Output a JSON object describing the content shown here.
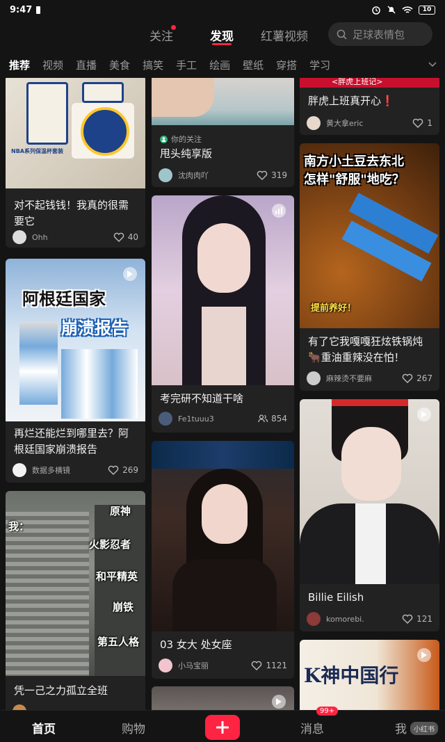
{
  "status": {
    "time": "9:47",
    "battery": "10"
  },
  "top_nav": {
    "follow": "关注",
    "discover": "发现",
    "video": "红薯视频",
    "search_placeholder": "足球表情包"
  },
  "categories": [
    "推荐",
    "视频",
    "直播",
    "美食",
    "搞笑",
    "手工",
    "绘画",
    "壁纸",
    "穿搭",
    "学习"
  ],
  "cards": [
    {
      "title_line1": "对不起钱钱！我真的很需",
      "title_line2": "要它",
      "author": "Ohh",
      "likes": "40",
      "img_text_a": "WARRIORS",
      "img_text_b": "NBA系列保温杯套装"
    },
    {
      "title_line1": "再烂还能烂到哪里去？阿",
      "title_line2": "根廷国家崩溃报告",
      "author": "数据多横镜",
      "likes": "269",
      "img_text_a": "阿根廷国家",
      "img_text_b": "崩溃报告"
    },
    {
      "title_line1": "凭一己之力孤立全班",
      "author": "",
      "likes": "",
      "img_text_a": "我：",
      "labels": [
        "原神",
        "火影忍者",
        "和平精英",
        "崩铁",
        "第五人格"
      ]
    },
    {
      "follow_tag": "你的关注",
      "title_line1": "甩头纯享版",
      "author": "沈肉肉吖",
      "likes": "319"
    },
    {
      "title_line1": "考完研不知道干啥",
      "author": "Fe1tuuu3",
      "likes": "854"
    },
    {
      "title_line1": "03 女大 处女座",
      "author": "小马宝丽",
      "likes": "1121"
    },
    {
      "title_line1": "胖虎上班真开心❗",
      "author": "黄大拿eric",
      "likes": "1",
      "img_text_a": "<胖虎上班记>"
    },
    {
      "title_line1": "有了它我嘎嘎狂炫铁锅炖",
      "title_line2": "🐂重油重辣没在怕！",
      "author": "麻辣烫不要麻",
      "likes": "267",
      "img_text_a": "南方小土豆去东北",
      "img_text_b": "怎样\"舒服\"地吃？",
      "img_text_c": "提前养好！"
    },
    {
      "title_line1": "Billie Eilish",
      "author": "komorebi.",
      "likes": "121"
    },
    {
      "img_text_a": "K神中国行"
    }
  ],
  "bottom_nav": {
    "home": "首页",
    "shop": "购物",
    "messages": "消息",
    "messages_badge": "99+",
    "me": "我",
    "logo": "小红书"
  }
}
